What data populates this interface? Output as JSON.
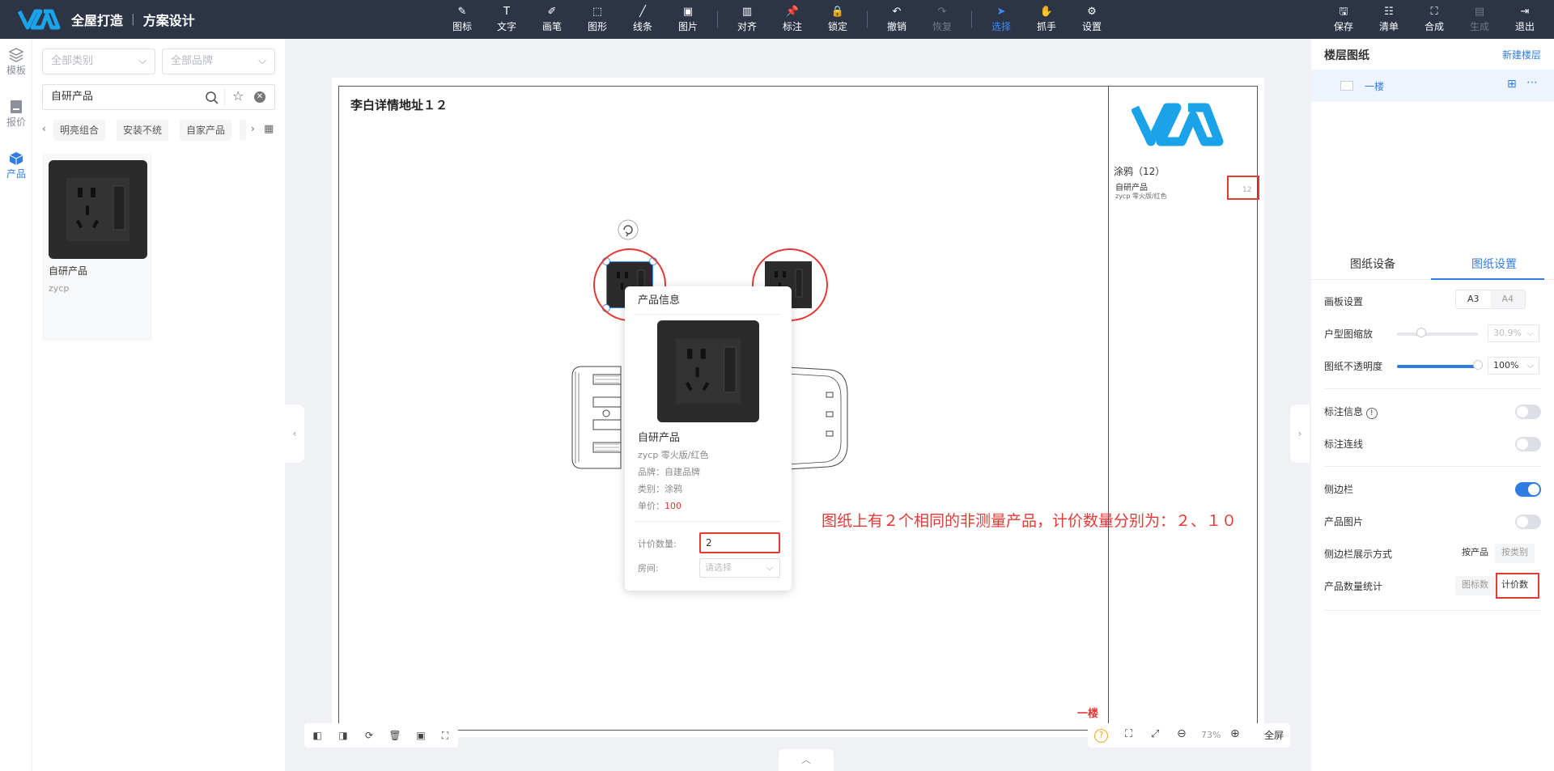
{
  "app": {
    "name": "全屋打造",
    "separator": "|",
    "module": "方案设计"
  },
  "toolbar": {
    "tools": [
      {
        "label": "图标",
        "icon": "icon-tool-icon"
      },
      {
        "label": "文字",
        "icon": "text-icon"
      },
      {
        "label": "画笔",
        "icon": "brush-icon"
      },
      {
        "label": "图形",
        "icon": "shape-icon"
      },
      {
        "label": "线条",
        "icon": "line-icon"
      },
      {
        "label": "图片",
        "icon": "image-icon"
      },
      {
        "label": "对齐",
        "icon": "align-icon"
      },
      {
        "label": "标注",
        "icon": "pin-icon"
      },
      {
        "label": "锁定",
        "icon": "lock-icon"
      },
      {
        "label": "撤销",
        "icon": "undo-icon"
      },
      {
        "label": "恢复",
        "icon": "redo-icon"
      },
      {
        "label": "选择",
        "icon": "cursor-icon"
      },
      {
        "label": "抓手",
        "icon": "hand-icon"
      },
      {
        "label": "设置",
        "icon": "gear-icon"
      }
    ],
    "actions": [
      {
        "label": "保存",
        "icon": "save-icon"
      },
      {
        "label": "清单",
        "icon": "list-icon"
      },
      {
        "label": "合成",
        "icon": "compose-icon"
      },
      {
        "label": "生成",
        "icon": "generate-icon"
      },
      {
        "label": "退出",
        "icon": "exit-icon"
      }
    ]
  },
  "leftrail": {
    "items": [
      {
        "label": "模板",
        "icon": "layers-icon"
      },
      {
        "label": "报价",
        "icon": "quote-icon"
      },
      {
        "label": "产品",
        "icon": "cube-icon"
      }
    ]
  },
  "leftpanel": {
    "category_placeholder": "全部类别",
    "brand_placeholder": "全部品牌",
    "search_value": "自研产品",
    "chips": [
      "明亮组合",
      "安装不统",
      "自家产品"
    ],
    "product": {
      "name": "自研产品",
      "brand": "zycp"
    }
  },
  "canvas": {
    "doc_title": "李白详情地址１２",
    "floor_tag": "一楼",
    "sidebar": {
      "category": "涂鸦（12）",
      "item_name": "自研产品",
      "item_sub": "zycp 零火版/红色",
      "qty": "12"
    },
    "annotation": "图纸上有２个相同的非测量产品，计价数量分别为：２、１０"
  },
  "popover": {
    "title": "产品信息",
    "name": "自研产品",
    "spec": "zycp 零火版/红色",
    "brand_label": "品牌：",
    "brand": "自建品牌",
    "category_label": "类别：",
    "category": "涂鸦",
    "price_label": "单价：",
    "price": "100",
    "qty_label": "计价数量:",
    "qty_value": "2",
    "room_label": "房间:",
    "room_placeholder": "请选择"
  },
  "zoom": {
    "level": "73%",
    "fullscreen_label": "全屏"
  },
  "rightpanel": {
    "title": "楼层图纸",
    "new_floor": "新建楼层",
    "floor_name": "一楼",
    "tabs": [
      "图纸设备",
      "图纸设置"
    ],
    "active_tab": 1,
    "settings": {
      "board_label": "画板设置",
      "board_options": [
        "A3",
        "A4"
      ],
      "board_selected": "A3",
      "scale_label": "户型图缩放",
      "scale_value": "30.9%",
      "scale_fraction": 0.3,
      "opacity_label": "图纸不透明度",
      "opacity_value": "100%",
      "opacity_fraction": 1.0,
      "mark_info_label": "标注信息",
      "mark_info_on": false,
      "mark_line_label": "标注连线",
      "mark_line_on": false,
      "sidebar_label": "侧边栏",
      "sidebar_on": true,
      "product_img_label": "产品图片",
      "product_img_on": false,
      "sidebar_mode_label": "侧边栏展示方式",
      "sidebar_mode_options": [
        "按产品",
        "按类别"
      ],
      "sidebar_mode_selected": "按产品",
      "count_label": "产品数量统计",
      "count_options": [
        "图标数",
        "计价数"
      ],
      "count_selected": "计价数"
    }
  },
  "colors": {
    "topbar": "#2c3446",
    "accent": "#2f7de1",
    "highlight": "#e53935",
    "logo": "#1aa3e8"
  }
}
